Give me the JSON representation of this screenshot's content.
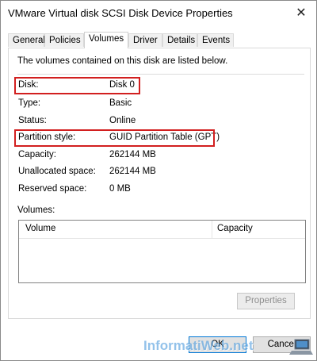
{
  "window": {
    "title": "VMware Virtual disk SCSI Disk Device Properties",
    "close_glyph": "✕"
  },
  "tabs": [
    {
      "label": "General"
    },
    {
      "label": "Policies"
    },
    {
      "label": "Volumes"
    },
    {
      "label": "Driver"
    },
    {
      "label": "Details"
    },
    {
      "label": "Events"
    }
  ],
  "panel": {
    "description": "The volumes contained on this disk are listed below.",
    "fields": [
      {
        "label": "Disk:",
        "value": "Disk 0"
      },
      {
        "label": "Type:",
        "value": "Basic"
      },
      {
        "label": "Status:",
        "value": "Online"
      },
      {
        "label": "Partition style:",
        "value": "GUID Partition Table (GPT)"
      },
      {
        "label": "Capacity:",
        "value": "262144 MB"
      },
      {
        "label": "Unallocated space:",
        "value": "262144 MB"
      },
      {
        "label": "Reserved space:",
        "value": "0 MB"
      }
    ],
    "volumes_label": "Volumes:",
    "columns": [
      "Volume",
      "Capacity"
    ],
    "properties_button": "Properties"
  },
  "buttons": {
    "ok": "OK",
    "cancel": "Cancel"
  },
  "watermark": {
    "text": "InformatiWeb.net"
  },
  "colors": {
    "highlight": "#d21f1f",
    "accent": "#0078d7",
    "watermark": "#5aa3e0"
  }
}
